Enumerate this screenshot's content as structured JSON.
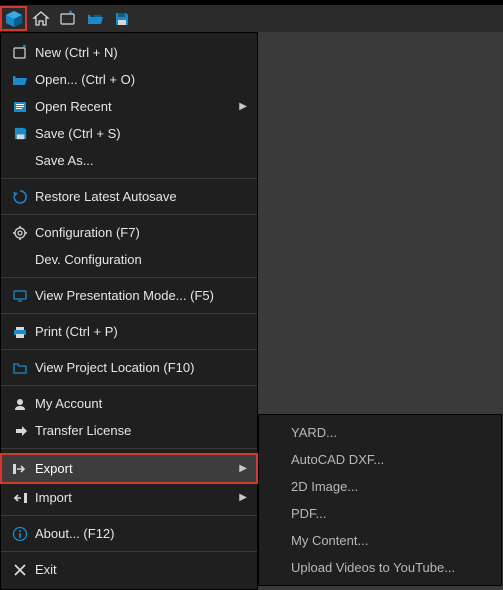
{
  "toolbar": {
    "items": [
      {
        "name": "app-logo-icon",
        "selected": true
      },
      {
        "name": "home-icon"
      },
      {
        "name": "new-project-icon"
      },
      {
        "name": "open-folder-icon"
      },
      {
        "name": "save-icon"
      }
    ]
  },
  "menu": {
    "groups": [
      [
        {
          "label": "New (Ctrl + N)",
          "icon": "new-icon",
          "name": "menu-new"
        },
        {
          "label": "Open... (Ctrl + O)",
          "icon": "open-icon",
          "name": "menu-open"
        },
        {
          "label": "Open Recent",
          "icon": "recent-icon",
          "name": "menu-open-recent",
          "submenu": true
        },
        {
          "label": "Save (Ctrl + S)",
          "icon": "save-icon",
          "name": "menu-save"
        },
        {
          "label": "Save As...",
          "icon": null,
          "name": "menu-save-as"
        }
      ],
      [
        {
          "label": "Restore Latest Autosave",
          "icon": "restore-icon",
          "name": "menu-restore-autosave"
        }
      ],
      [
        {
          "label": "Configuration (F7)",
          "icon": "gear-icon",
          "name": "menu-configuration"
        },
        {
          "label": "Dev. Configuration",
          "icon": null,
          "name": "menu-dev-configuration"
        }
      ],
      [
        {
          "label": "View Presentation Mode... (F5)",
          "icon": "monitor-icon",
          "name": "menu-presentation"
        }
      ],
      [
        {
          "label": "Print (Ctrl + P)",
          "icon": "print-icon",
          "name": "menu-print"
        }
      ],
      [
        {
          "label": "View Project Location (F10)",
          "icon": "folder-icon",
          "name": "menu-project-location"
        }
      ],
      [
        {
          "label": "My Account",
          "icon": "user-icon",
          "name": "menu-my-account"
        },
        {
          "label": "Transfer License",
          "icon": "transfer-icon",
          "name": "menu-transfer-license"
        }
      ],
      [
        {
          "label": "Export",
          "icon": "export-icon",
          "name": "menu-export",
          "submenu": true,
          "highlight": true
        },
        {
          "label": "Import",
          "icon": "import-icon",
          "name": "menu-import",
          "submenu": true
        }
      ],
      [
        {
          "label": "About... (F12)",
          "icon": "info-icon",
          "name": "menu-about"
        }
      ],
      [
        {
          "label": "Exit",
          "icon": "close-icon",
          "name": "menu-exit"
        }
      ]
    ]
  },
  "submenu": {
    "items": [
      {
        "label": "YARD...",
        "name": "export-yard"
      },
      {
        "label": "AutoCAD DXF...",
        "name": "export-dxf"
      },
      {
        "label": "2D Image...",
        "name": "export-2d-image"
      },
      {
        "label": "PDF...",
        "name": "export-pdf"
      },
      {
        "label": "My Content...",
        "name": "export-my-content"
      },
      {
        "label": "Upload Videos to YouTube...",
        "name": "export-youtube"
      }
    ]
  }
}
